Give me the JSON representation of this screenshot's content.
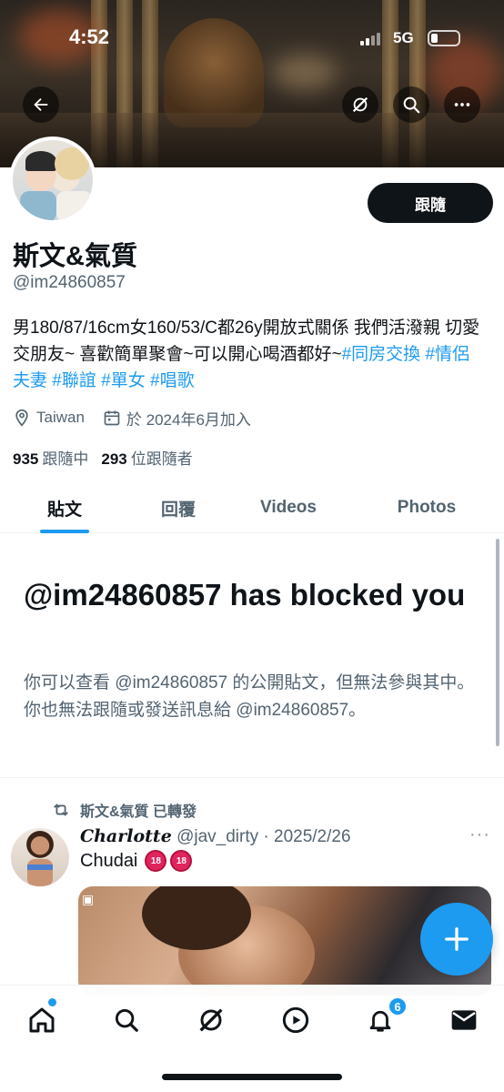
{
  "status_bar": {
    "time": "4:52",
    "network": "5G"
  },
  "profile": {
    "display_name": "斯文&氣質",
    "handle": "@im24860857",
    "follow_label": "跟隨",
    "bio_text": "男180/87/16cm女160/53/C都26y開放式關係 我們活潑親 切愛交朋友~ 喜歡簡單聚會~可以開心喝酒都好~",
    "bio_tags": [
      "#同房交換",
      "#情侶夫妻",
      "#聯誼",
      "#單女",
      "#唱歌"
    ],
    "location": "Taiwan",
    "joined": "於 2024年6月加入",
    "following_count": "935",
    "following_label": "跟隨中",
    "followers_count": "293",
    "followers_label": "位跟隨者"
  },
  "tabs": [
    {
      "label": "貼文",
      "active": true
    },
    {
      "label": "回覆",
      "active": false
    },
    {
      "label": "Videos",
      "active": false
    },
    {
      "label": "Photos",
      "active": false
    }
  ],
  "blocked": {
    "title": "@im24860857 has blocked you",
    "description": "你可以查看 @im24860857 的公開貼文，但無法參與其中。你也無法跟隨或發送訊息給 @im24860857。"
  },
  "post": {
    "retweeted_by": "斯文&氣質 已轉發",
    "author": "Charlotte",
    "handle_date": "@jav_dirty · 2025/2/26",
    "text": "Chudai",
    "age_badge": "18",
    "more": "···"
  },
  "bottom_nav": {
    "notification_count": "6",
    "items": [
      "home-icon",
      "search-icon",
      "grok-icon",
      "video-icon",
      "notifications-icon",
      "messages-icon"
    ]
  },
  "colors": {
    "accent": "#1d9bf0",
    "text": "#0f1419",
    "secondary": "#536471"
  }
}
